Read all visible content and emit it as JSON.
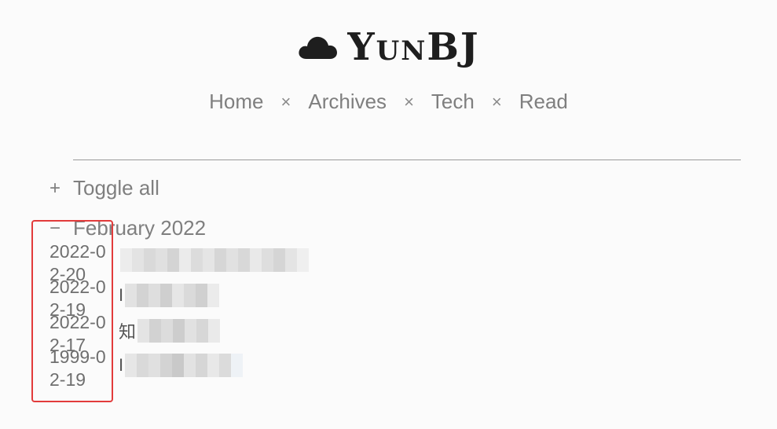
{
  "site": {
    "title": "YunBJ",
    "logo_icon": "cloud-icon"
  },
  "nav": {
    "items": [
      "Home",
      "Archives",
      "Tech",
      "Read"
    ],
    "separator": "×"
  },
  "archive": {
    "toggle_symbol": "+",
    "toggle_label": "Toggle all",
    "month_symbol": "−",
    "month_label": "February 2022",
    "posts": [
      {
        "date": "2022-02-20",
        "title_glyph": ""
      },
      {
        "date": "2022-02-19",
        "title_glyph": "I"
      },
      {
        "date": "2022-02-17",
        "title_glyph": "知"
      },
      {
        "date": "1999-02-19",
        "title_glyph": "I"
      }
    ]
  },
  "colors": {
    "highlight": "#e23b3b",
    "text": "#7f7f7f",
    "title": "#1e1e1e"
  }
}
